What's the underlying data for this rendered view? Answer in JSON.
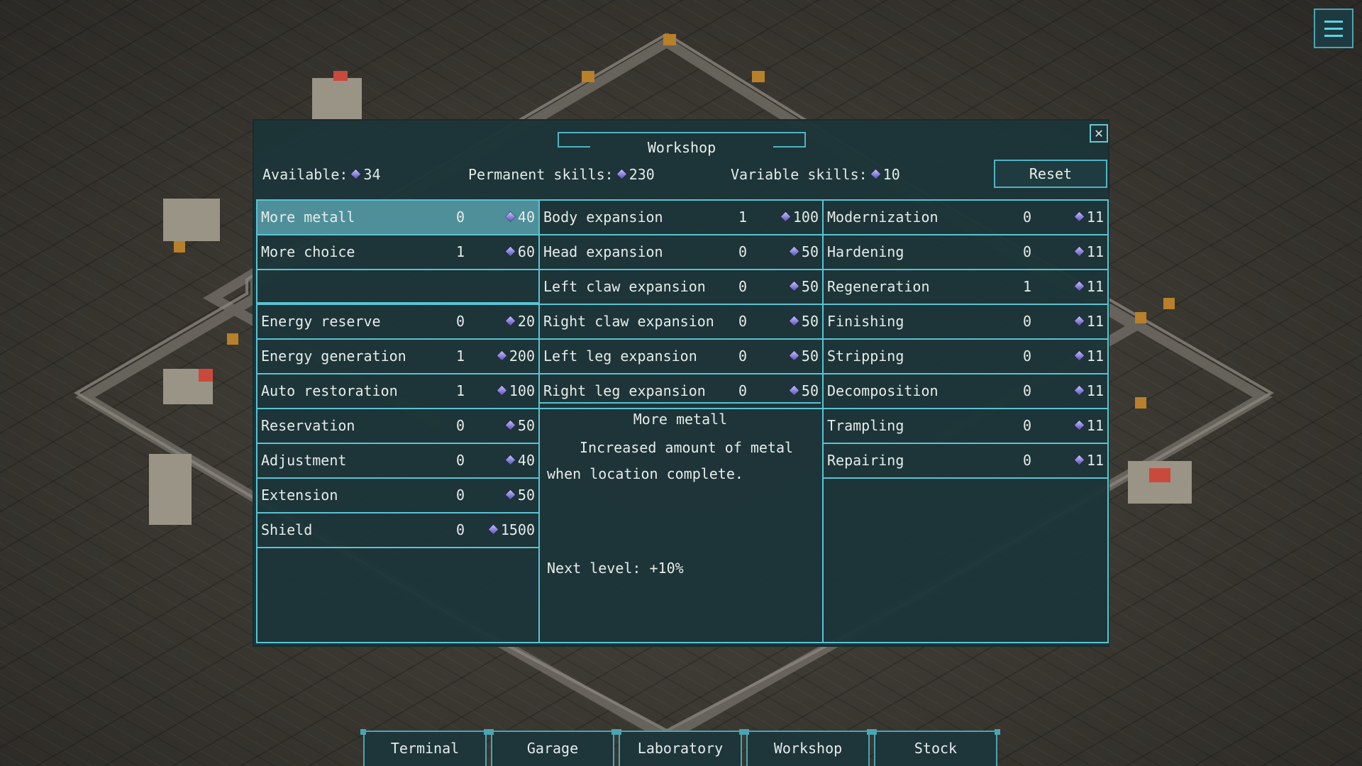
{
  "window": {
    "title": "Workshop",
    "close_icon": "close-icon",
    "available_label": "Available:",
    "available_value": "34",
    "permanent_label": "Permanent skills:",
    "permanent_value": "230",
    "variable_label": "Variable skills:",
    "variable_value": "10",
    "reset_label": "Reset"
  },
  "column1_top": [
    {
      "name": "More metall",
      "level": "0",
      "cost": "40",
      "selected": true
    },
    {
      "name": "More choice",
      "level": "1",
      "cost": "60"
    }
  ],
  "column1_bottom": [
    {
      "name": "Energy reserve",
      "level": "0",
      "cost": "20"
    },
    {
      "name": "Energy generation",
      "level": "1",
      "cost": "200"
    },
    {
      "name": "Auto restoration",
      "level": "1",
      "cost": "100"
    },
    {
      "name": "Reservation",
      "level": "0",
      "cost": "50"
    },
    {
      "name": "Adjustment",
      "level": "0",
      "cost": "40"
    },
    {
      "name": "Extension",
      "level": "0",
      "cost": "50"
    },
    {
      "name": "Shield",
      "level": "0",
      "cost": "1500"
    }
  ],
  "column2": [
    {
      "name": "Body expansion",
      "level": "1",
      "cost": "100"
    },
    {
      "name": "Head expansion",
      "level": "0",
      "cost": "50"
    },
    {
      "name": "Left claw expansion",
      "level": "0",
      "cost": "50"
    },
    {
      "name": "Right claw expansion",
      "level": "0",
      "cost": "50"
    },
    {
      "name": "Left leg expansion",
      "level": "0",
      "cost": "50"
    },
    {
      "name": "Right leg expansion",
      "level": "0",
      "cost": "50"
    }
  ],
  "description": {
    "title": "More metall",
    "text": "Increased amount of metal when location complete.",
    "next_level": "Next level: +10%"
  },
  "column3": [
    {
      "name": "Modernization",
      "level": "0",
      "cost": "11"
    },
    {
      "name": "Hardening",
      "level": "0",
      "cost": "11"
    },
    {
      "name": "Regeneration",
      "level": "1",
      "cost": "11"
    },
    {
      "name": "Finishing",
      "level": "0",
      "cost": "11"
    },
    {
      "name": "Stripping",
      "level": "0",
      "cost": "11"
    },
    {
      "name": "Decomposition",
      "level": "0",
      "cost": "11"
    },
    {
      "name": "Trampling",
      "level": "0",
      "cost": "11"
    },
    {
      "name": "Repairing",
      "level": "0",
      "cost": "11"
    }
  ],
  "nav": [
    "Terminal",
    "Garage",
    "Laboratory",
    "Workshop",
    "Stock"
  ],
  "colors": {
    "accent": "#58c4d4",
    "panel": "#1c3438",
    "selected": "#4f8f9a",
    "gem": "#8b82d8"
  },
  "icons": {
    "menu": "hamburger-menu-icon",
    "currency": "crystal-gem-icon"
  }
}
